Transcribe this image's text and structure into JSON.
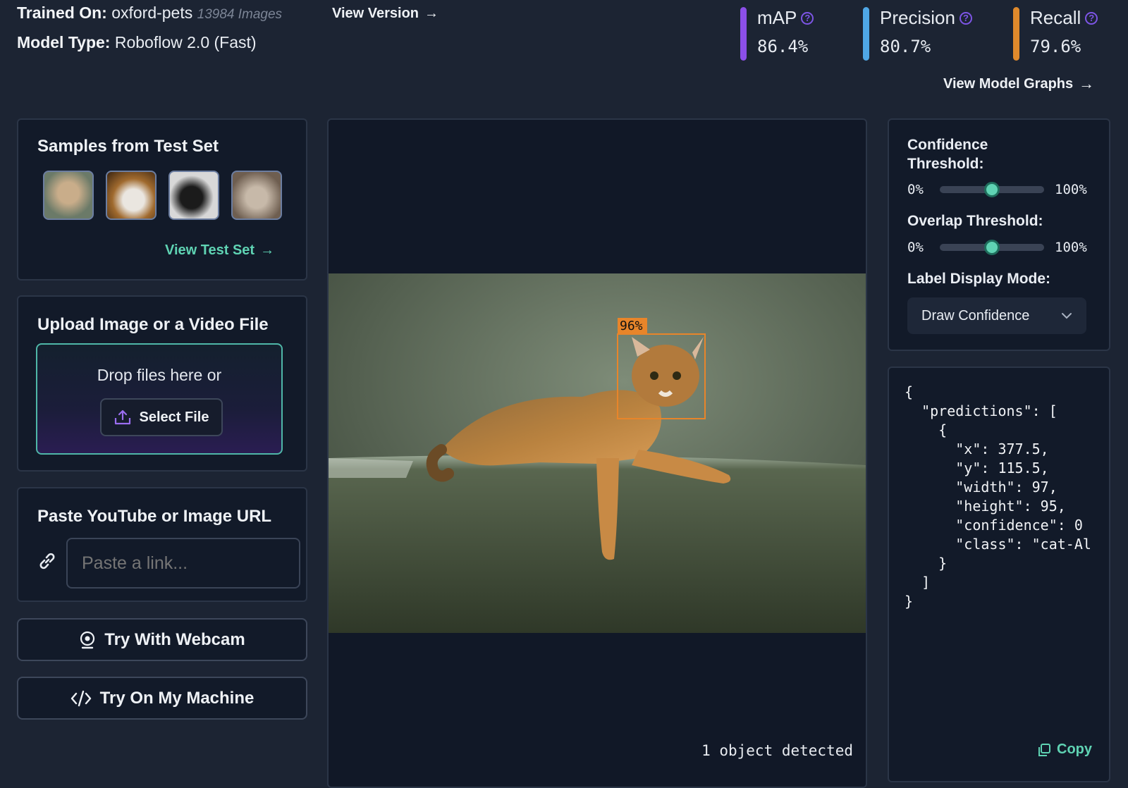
{
  "header": {
    "trained_on_label": "Trained On:",
    "trained_on_value": "oxford-pets",
    "image_count": "13984 Images",
    "view_version": "View Version",
    "model_type_label": "Model Type:",
    "model_type_value": "Roboflow 2.0 (Fast)",
    "view_model_graphs": "View Model Graphs"
  },
  "metrics": [
    {
      "name": "mAP",
      "value": "86.4%",
      "color": "#8c4fe8"
    },
    {
      "name": "Precision",
      "value": "80.7%",
      "color": "#4fa7e6"
    },
    {
      "name": "Recall",
      "value": "79.6%",
      "color": "#e08a2c"
    }
  ],
  "samples": {
    "title": "Samples from Test Set",
    "view_test_set": "View Test Set",
    "thumbnails": [
      "pug-thumbnail",
      "white-cat-thumbnail",
      "black-terrier-thumbnail",
      "fluffy-cat-thumbnail"
    ]
  },
  "upload": {
    "title": "Upload Image or a Video File",
    "drop_text": "Drop files here or",
    "select_file": "Select File"
  },
  "url": {
    "title": "Paste YouTube or Image URL",
    "placeholder": "Paste a link..."
  },
  "webcam_button": "Try With Webcam",
  "machine_button": "Try On My Machine",
  "viewer": {
    "box_label": "96%",
    "box_color": "#e8852a",
    "status": "1 object detected"
  },
  "controls": {
    "confidence_label_1": "Confidence",
    "confidence_label_2": "Threshold:",
    "confidence_min": "0%",
    "confidence_max": "100%",
    "confidence_value": 0.5,
    "overlap_label": "Overlap Threshold:",
    "overlap_min": "0%",
    "overlap_max": "100%",
    "overlap_value": 0.5,
    "label_mode_label": "Label Display Mode:",
    "label_mode_value": "Draw Confidence"
  },
  "json_output": {
    "lines": [
      "{",
      "  \"predictions\": [",
      "    {",
      "      \"x\": 377.5,",
      "      \"y\": 115.5,",
      "      \"width\": 97,",
      "      \"height\": 95,",
      "      \"confidence\": 0",
      "      \"class\": \"cat-Al",
      "    }",
      "  ]",
      "}"
    ],
    "copy": "Copy"
  }
}
